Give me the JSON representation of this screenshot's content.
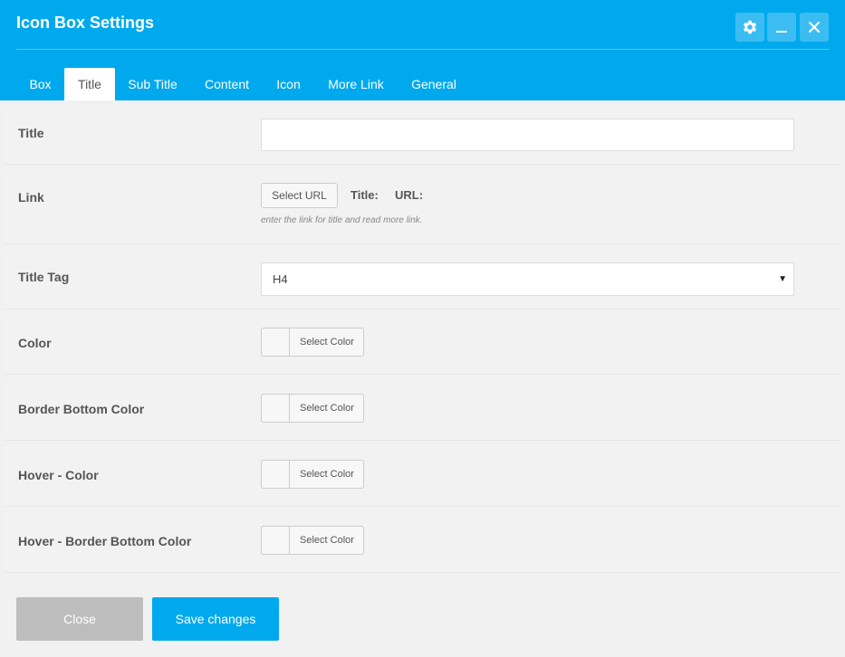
{
  "dialog": {
    "title": "Icon Box Settings"
  },
  "window_controls": [
    {
      "name": "settings-button",
      "icon": "gear-icon"
    },
    {
      "name": "minimize-button",
      "icon": "minimize-icon"
    },
    {
      "name": "close-window-button",
      "icon": "close-icon"
    }
  ],
  "tabs": [
    {
      "label": "Box",
      "active": false
    },
    {
      "label": "Title",
      "active": true
    },
    {
      "label": "Sub Title",
      "active": false
    },
    {
      "label": "Content",
      "active": false
    },
    {
      "label": "Icon",
      "active": false
    },
    {
      "label": "More Link",
      "active": false
    },
    {
      "label": "General",
      "active": false
    }
  ],
  "fields": {
    "title": {
      "label": "Title",
      "value": ""
    },
    "link": {
      "label": "Link",
      "button": "Select URL",
      "title_label": "Title:",
      "url_label": "URL:",
      "hint": "enter the link for title and read more link."
    },
    "title_tag": {
      "label": "Title Tag",
      "value": "H4"
    },
    "color": {
      "label": "Color",
      "button": "Select Color"
    },
    "border_bottom_color": {
      "label": "Border Bottom Color",
      "button": "Select Color"
    },
    "hover_color": {
      "label": "Hover - Color",
      "button": "Select Color"
    },
    "hover_border_bottom_color": {
      "label": "Hover - Border Bottom Color",
      "button": "Select Color"
    }
  },
  "footer": {
    "close_label": "Close",
    "save_label": "Save changes"
  },
  "colors": {
    "accent": "#00a9ed",
    "close_button": "#bdbdbd"
  }
}
